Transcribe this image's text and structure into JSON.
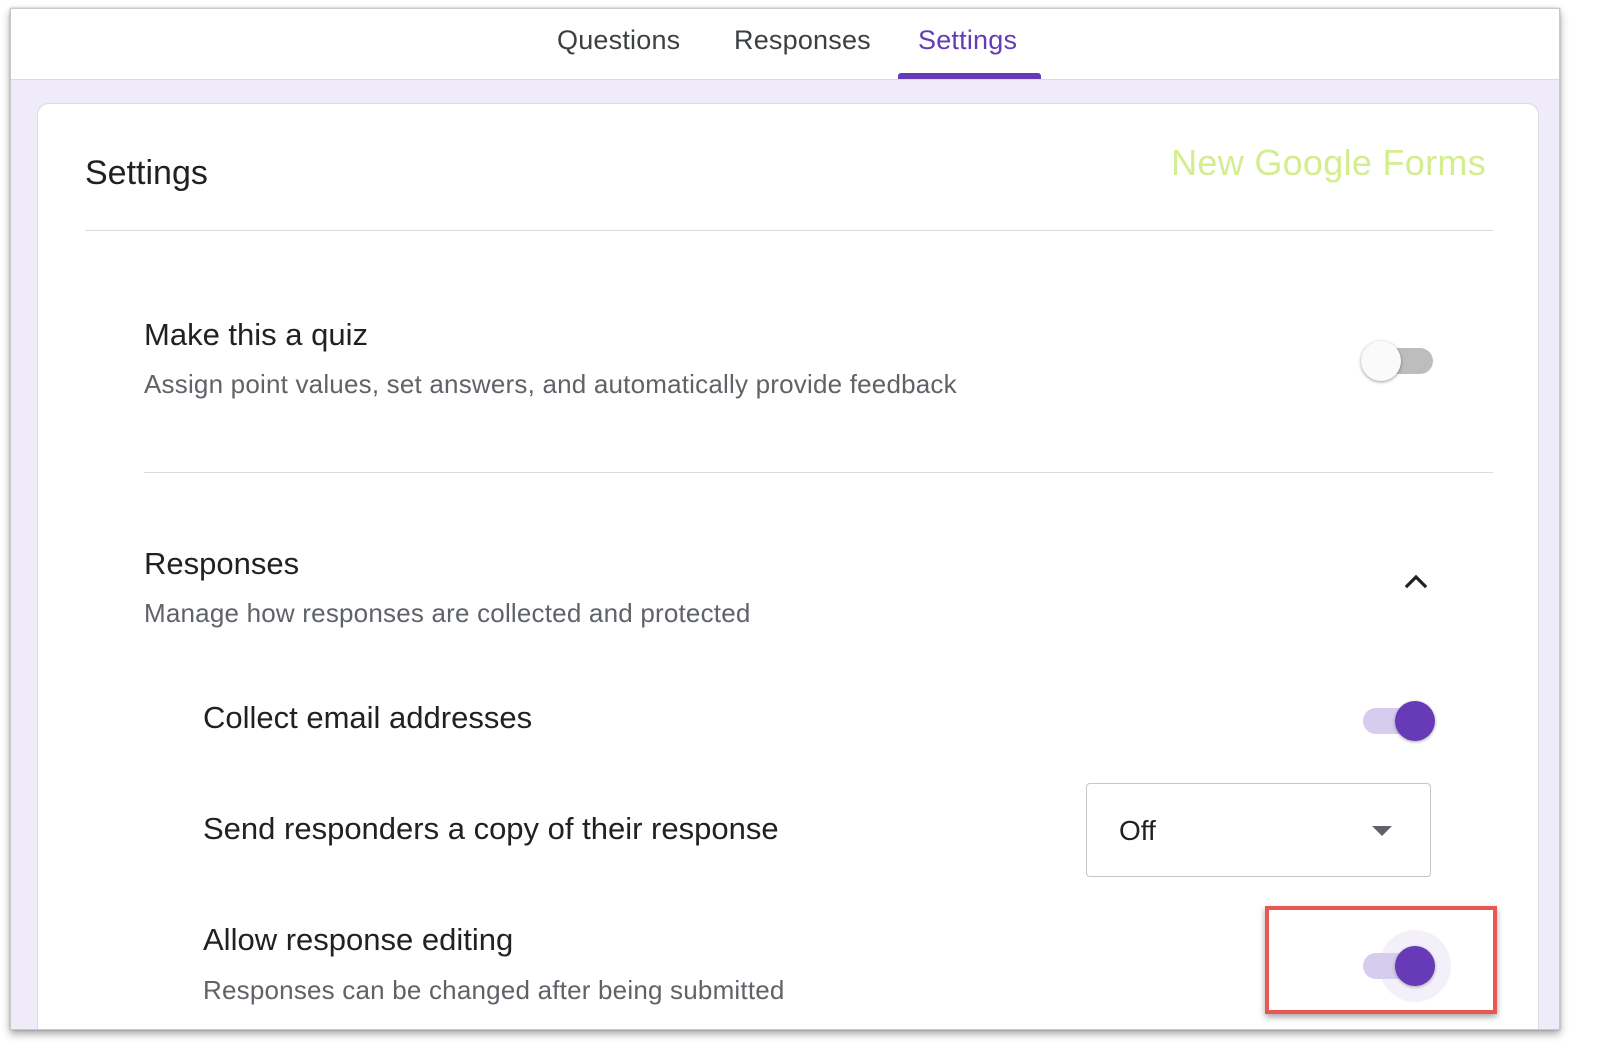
{
  "tabs": {
    "questions": "Questions",
    "responses": "Responses",
    "settings": "Settings",
    "active": "Settings"
  },
  "card": {
    "title": "Settings",
    "brand_label": "New Google Forms"
  },
  "quiz": {
    "title": "Make this a quiz",
    "description": "Assign point values, set answers, and automatically provide feedback",
    "enabled": false
  },
  "responses_section": {
    "title": "Responses",
    "description": "Manage how responses are collected and protected",
    "expanded": true,
    "collect_email": {
      "label": "Collect email addresses",
      "enabled": true
    },
    "send_copy": {
      "label": "Send responders a copy of their response",
      "value": "Off"
    },
    "allow_editing": {
      "label": "Allow response editing",
      "description": "Responses can be changed after being submitted",
      "enabled": true
    }
  },
  "colors": {
    "accent": "#673ab7",
    "brand_label": "#d4ed8e",
    "highlight": "#e8584f",
    "background": "#f0ebf8"
  },
  "icons": {
    "collapse": "chevron-up-icon",
    "dropdown": "arrow-drop-down-icon"
  }
}
